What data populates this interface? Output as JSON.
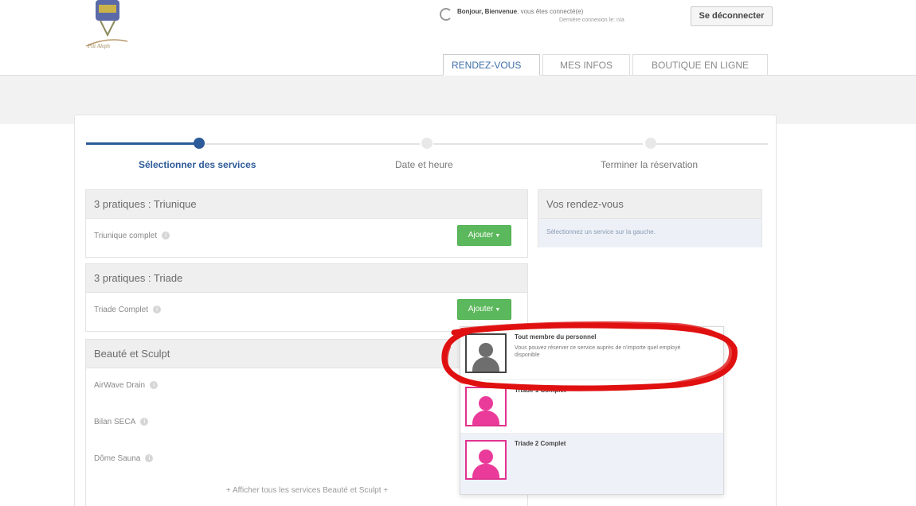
{
  "header": {
    "logo_alt": "logo",
    "user_greeting_bold": "Bonjour, Bienvenue",
    "user_greeting_rest": ", vous êtes connecté(e)",
    "last_connection": "Dernière connexion le: n/a",
    "logout_label": "Se déconnecter"
  },
  "tabs": [
    {
      "label": "RENDEZ-VOUS",
      "active": true
    },
    {
      "label": "MES INFOS",
      "active": false
    },
    {
      "label": "BOUTIQUE EN LIGNE",
      "active": false
    }
  ],
  "stepper": {
    "steps": [
      {
        "label": "Sélectionner des services",
        "active": true
      },
      {
        "label": "Date et heure",
        "active": false
      },
      {
        "label": "Terminer la réservation",
        "active": false
      }
    ]
  },
  "categories": [
    {
      "title": "3 pratiques : Triunique",
      "services": [
        {
          "name": "Triunique complet",
          "button": "Ajouter"
        }
      ]
    },
    {
      "title": "3 pratiques : Triade",
      "services": [
        {
          "name": "Triade Complet",
          "button": "Ajouter"
        }
      ]
    },
    {
      "title": "Beauté et Sculpt",
      "services": [
        {
          "name": "AirWave Drain"
        },
        {
          "name": "Bilan SECA"
        },
        {
          "name": "Dôme Sauna"
        }
      ],
      "show_all": "Afficher tous les services Beauté et Sculpt"
    }
  ],
  "appointments": {
    "title": "Vos rendez-vous",
    "empty_text": "Sélectionnez un service sur la gauche."
  },
  "staff_dropdown": [
    {
      "name": "Tout membre du personnel",
      "desc": "Vous pouvez réserver ce service auprès de n'importe quel employé disponible",
      "avatar": "neutral"
    },
    {
      "name": "Triade 1 Complet",
      "desc": "",
      "avatar": "pink"
    },
    {
      "name": "Triade 2 Complet",
      "desc": "",
      "avatar": "pink"
    }
  ],
  "colors": {
    "primary": "#2d5a99",
    "add_button": "#5cb85c",
    "highlight_circle": "#e01010",
    "avatar_pink": "#ea3b9a"
  }
}
